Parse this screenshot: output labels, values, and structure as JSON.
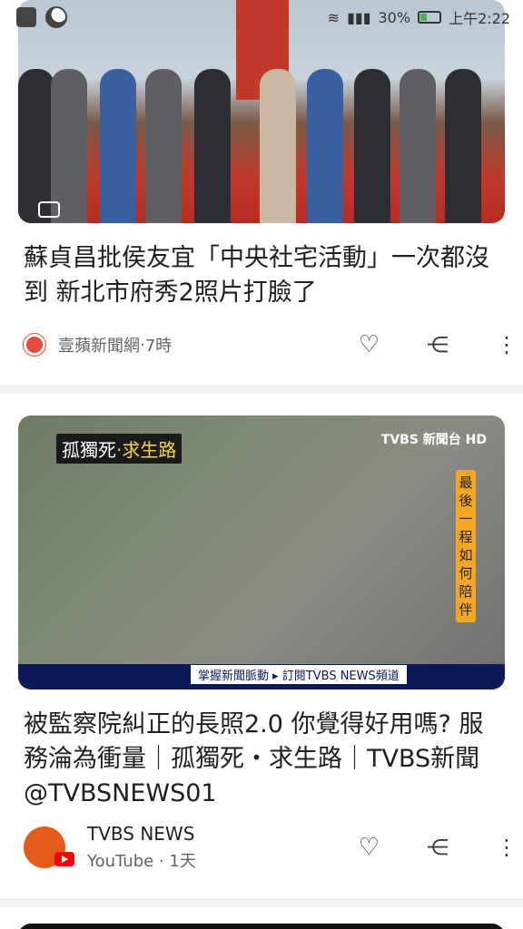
{
  "status_bar": {
    "battery_percent": "30%",
    "time": "上午2:22"
  },
  "cards": [
    {
      "title": "蘇貞昌批侯友宜「中央社宅活動」一次都沒到 新北市府秀2照片打臉了",
      "source": "壹蘋新聞網",
      "separator": " · ",
      "age": "7時"
    },
    {
      "overlay_tag_left": "孤獨死",
      "overlay_tag_sep": "·",
      "overlay_tag_right": "求生路",
      "overlay_channel": "TVBS 新聞台 HD",
      "overlay_vertical": "最後一程如何陪伴",
      "overlay_ticker": "掌握新聞脈動 ▸ 訂閱TVBS NEWS頻道",
      "title": "被監察院糾正的長照2.0 你覺得好用嗎? 服務淪為衝量｜孤獨死・求生路｜TVBS新聞@TVBSNEWS01",
      "channel": "TVBS NEWS",
      "source": "YouTube",
      "separator": " · ",
      "age": "1天"
    }
  ]
}
